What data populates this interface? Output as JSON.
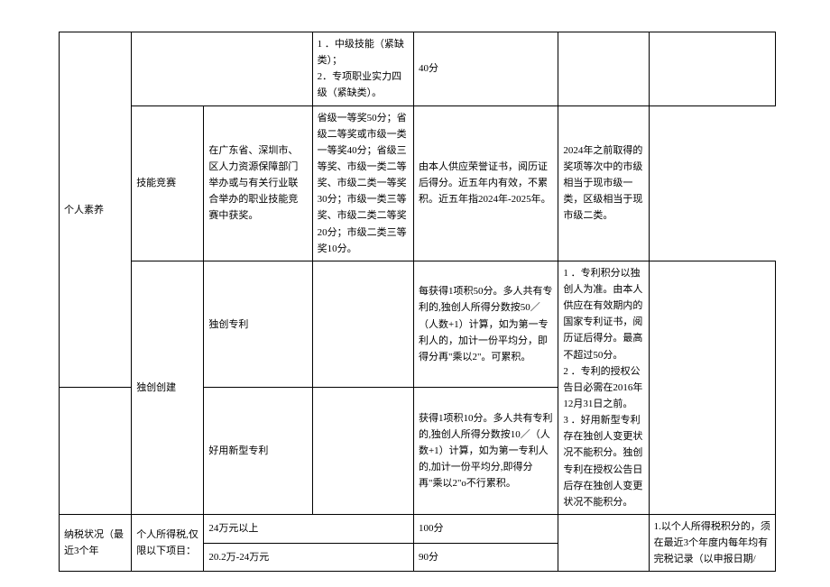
{
  "rows": {
    "r0_c3": "1       ．中级技能（紧缺类）；\n2．专项职业实力四级（紧缺类）。",
    "r0_c4": "40分",
    "r1_c1": "个人素养",
    "r1_c2": "技能竞赛",
    "r1_c3": "在广东省、深圳市、区人力资源保障部门举办或与有关行业联合举办的职业技能竞赛中获奖。",
    "r1_c4": "省级一等奖50分；省级二等奖或市级一类一等奖40分；省级三等奖、市级一类二等奖、市级二类一等奖30分；市级一类三等奖、市级二类二等奖20分；市级二类三等奖10分。",
    "r1_c5": "由本人供应荣誉证书，阅历证后得分。近五年内有效，不累积。近五年指2024年-2025年。",
    "r1_c6": "2024年之前取得的奖项等次中的市级相当于现市级一类，区级相当于现市级二类。",
    "r2_c2": "独创创建",
    "r2_c2a": "独创专利",
    "r2_c4": "每获得1项积50分。多人共有专利的,独创人所得分数按50／（人数+1）计算，如为第一专利人的，加计一份平均分，即得分再\"乘以2\"。可累积。",
    "r2_c5": "1       ．专利积分以独创人为准。由本人供应在有效期内的国家专利证书，阅历证后得分。最高不超过50分。\n2       ．专利的授权公告日必需在2016年12月31日之前。\n3       ．好用新型专利存在独创人变更状况不能积分。独创专利在授权公告日后存在独创人变更状况不能积分。",
    "r3_c2a": "好用新型专利",
    "r3_c4": "获得1项积10分。多人共有专利的,独创人所得分数按10／（人数+1）计算，如为第一专利人的,加计一份平均分,即得分再\"乘以2\"o不行累积。",
    "r4_c1": "纳税状况（最近3个年",
    "r4_c2": "个人所得税,仅限以下项目：",
    "r4_c3": "24万元以上",
    "r4_c4": "100分",
    "r4_c6": "1.以个人所得税积分的，须在最近3个年度内每年均有完税记录（以申报日期/",
    "r5_c3": "20.2万-24万元",
    "r5_c4": "90分"
  }
}
